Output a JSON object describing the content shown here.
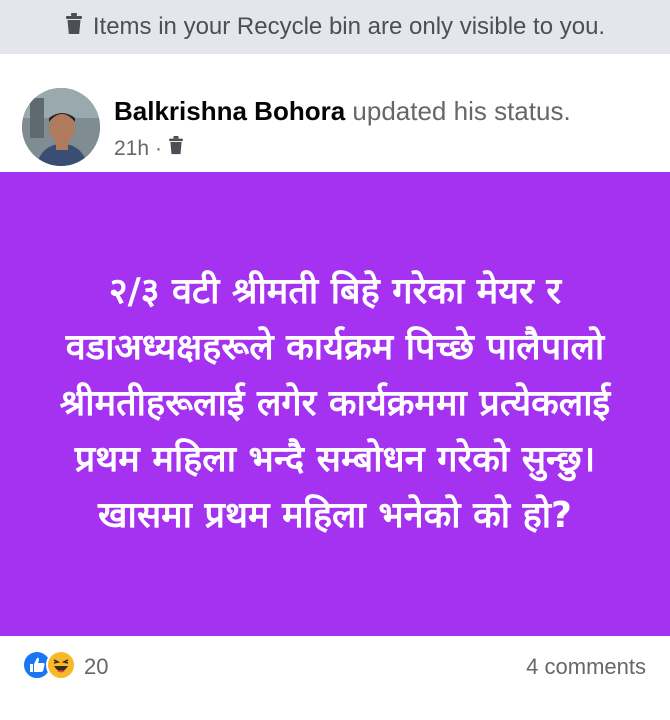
{
  "banner": {
    "icon": "trash-icon",
    "text": "Items in your Recycle bin are only visible to you."
  },
  "post": {
    "author": "Balkrishna Bohora",
    "action": "updated his status.",
    "time": "21h",
    "separator": "·",
    "audience_icon": "trash-icon",
    "background_color": "#a532f0",
    "text_color": "#ffffff",
    "body": "२/३ वटी श्रीमती बिहे गरेका मेयर र वडाअध्यक्षहरूले कार्यक्रम पिच्छे पालैपालो श्रीमतीहरूलाई लगेर कार्यक्रममा प्रत्येकलाई प्रथम महिला भन्दै सम्बोधन गरेको सुन्छु। खासमा प्रथम महिला भनेको को हो?"
  },
  "footer": {
    "reaction_icons": [
      "like-icon",
      "haha-icon"
    ],
    "reaction_count": "20",
    "comments": "4 comments"
  }
}
